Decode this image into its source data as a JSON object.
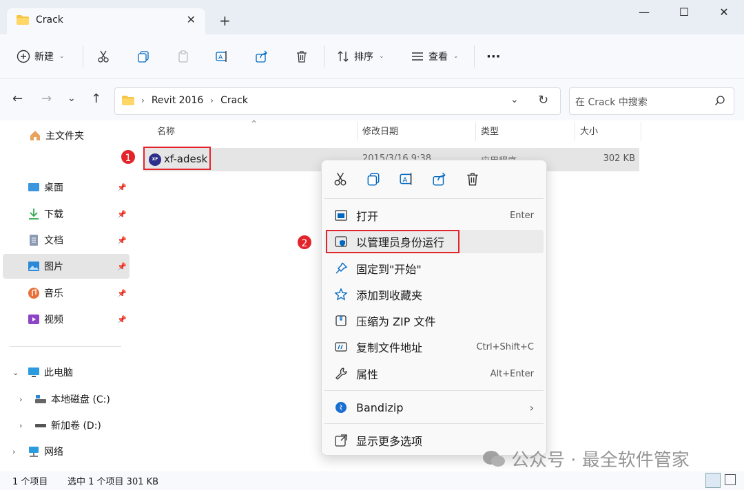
{
  "tab": {
    "title": "Crack",
    "close": "✕",
    "new_tab": "+"
  },
  "window": {
    "minimize": "—",
    "maximize": "☐",
    "close": "✕"
  },
  "toolbar": {
    "new_label": "新建",
    "sort_label": "排序",
    "view_label": "查看",
    "more_label": "···"
  },
  "address": {
    "crumbs": [
      "Revit 2016",
      "Crack"
    ],
    "search_placeholder": "在 Crack 中搜索"
  },
  "sidebar": {
    "home": "主文件夹",
    "quick": [
      "桌面",
      "下载",
      "文档",
      "图片",
      "音乐",
      "视频"
    ],
    "pc": "此电脑",
    "drives": [
      "本地磁盘 (C:)",
      "新加卷 (D:)"
    ],
    "network": "网络"
  },
  "columns": {
    "name": "名称",
    "date": "修改日期",
    "type": "类型",
    "size": "大小"
  },
  "file": {
    "name": "xf-adesk",
    "date": "2015/3/16 9:38",
    "type": "应用程序",
    "size": "302 KB",
    "icon_text": "XF"
  },
  "badges": {
    "one": "1",
    "two": "2"
  },
  "context_menu": {
    "items": [
      {
        "label": "打开",
        "shortcut": "Enter"
      },
      {
        "label": "以管理员身份运行",
        "shortcut": ""
      },
      {
        "label": "固定到\"开始\"",
        "shortcut": ""
      },
      {
        "label": "添加到收藏夹",
        "shortcut": ""
      },
      {
        "label": "压缩为 ZIP 文件",
        "shortcut": ""
      },
      {
        "label": "复制文件地址",
        "shortcut": "Ctrl+Shift+C"
      },
      {
        "label": "属性",
        "shortcut": "Alt+Enter"
      },
      {
        "label": "Bandizip",
        "shortcut": "›"
      },
      {
        "label": "显示更多选项",
        "shortcut": ""
      }
    ]
  },
  "status": {
    "count": "1 个项目",
    "selected": "选中 1 个项目  301 KB"
  },
  "watermark": "公众号 · 最全软件管家",
  "colors": {
    "accent": "#0067c0",
    "highlight_red": "#e3242b",
    "selection": "#e5e5e5"
  }
}
